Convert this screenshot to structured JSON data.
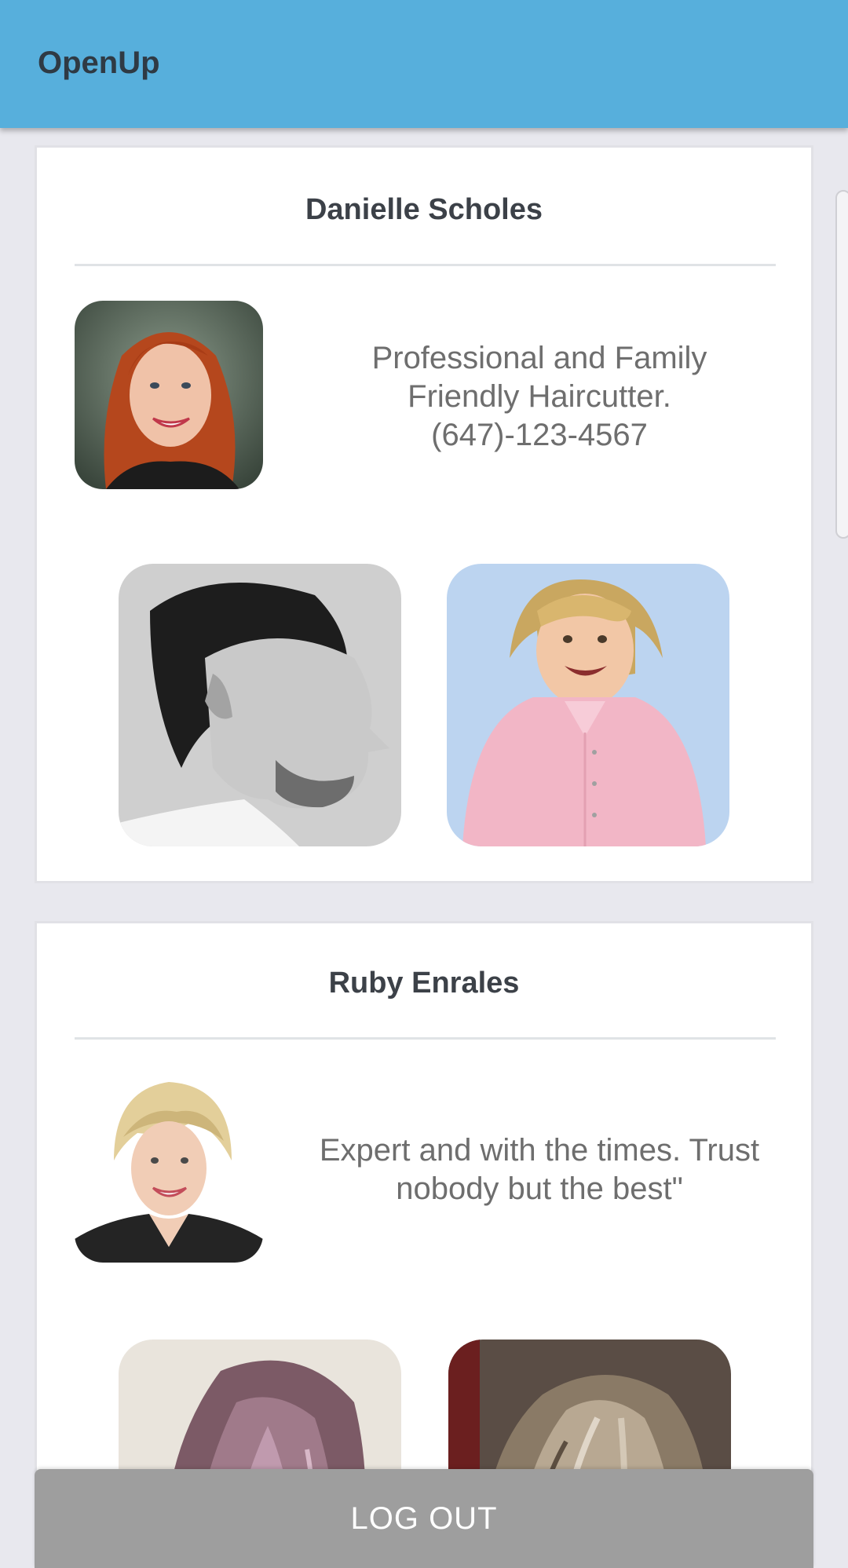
{
  "app": {
    "title": "OpenUp"
  },
  "stylists": [
    {
      "name": "Danielle Scholes",
      "description_lines": [
        "Professional and Family",
        "Friendly Haircutter.",
        "(647)-123-4567"
      ]
    },
    {
      "name": "Ruby Enrales",
      "description_lines": [
        "Expert and with the times. Trust",
        "nobody but the best\""
      ]
    }
  ],
  "actions": {
    "logout_label": "LOG OUT"
  },
  "colors": {
    "appbar": "#57afdc",
    "background": "#e8e8ee",
    "card": "#ffffff",
    "logout_button": "#9e9e9e"
  }
}
